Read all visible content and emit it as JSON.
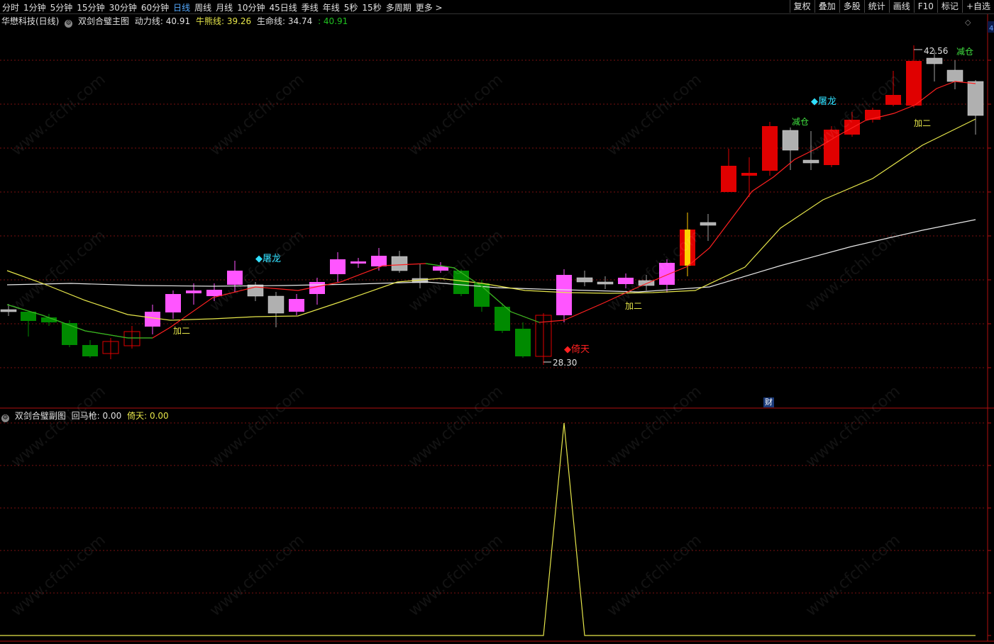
{
  "toolbar": {
    "periods": [
      "分时",
      "1分钟",
      "5分钟",
      "15分钟",
      "30分钟",
      "60分钟",
      "日线",
      "周线",
      "月线",
      "10分钟",
      "45日线",
      "季线",
      "年线",
      "5秒",
      "15秒",
      "多周期",
      "更多 >"
    ],
    "active_period": "日线",
    "right_buttons": [
      "复权",
      "叠加",
      "多股",
      "统计",
      "画线",
      "F10",
      "标记",
      "+自选"
    ]
  },
  "main_info": {
    "stock": "华懋科技(日线)",
    "indicator": "双剑合璧主图",
    "dongli_label": "动力线:",
    "dongli_value": "40.91",
    "niuxiong_label": "牛熊线:",
    "niuxiong_value": "39.26",
    "shengming_label": "生命线:",
    "shengming_value": "34.74",
    "extra_value": ": 40.91"
  },
  "sub_info": {
    "indicator": "双剑合璧副图",
    "huima_label": "回马枪:",
    "huima_value": "0.00",
    "yitian_label": "倚天:",
    "yitian_value": "0.00"
  },
  "annotations": {
    "high_price": "42.56",
    "low_price": "28.30",
    "tulong1": "◆屠龙",
    "tulong2": "◆屠龙",
    "yitian": "◆倚天",
    "jiaer1": "加二",
    "jiaer2": "加二",
    "jiaer3": "加二",
    "jiancang1": "减仓",
    "jiancang2": "减仓",
    "cai": "财",
    "scale_top": "4"
  },
  "colors": {
    "up_magenta": "#ff55ff",
    "up_red": "#e00000",
    "down_green": "#008a00",
    "neutral_gray": "#a0a0a0",
    "line_red": "#ff2020",
    "line_yellow": "#e6e64a",
    "line_white": "#e8e8e8",
    "line_green": "#20c020",
    "grid": "#7a1010"
  },
  "watermark": "www.cfchi.com"
}
